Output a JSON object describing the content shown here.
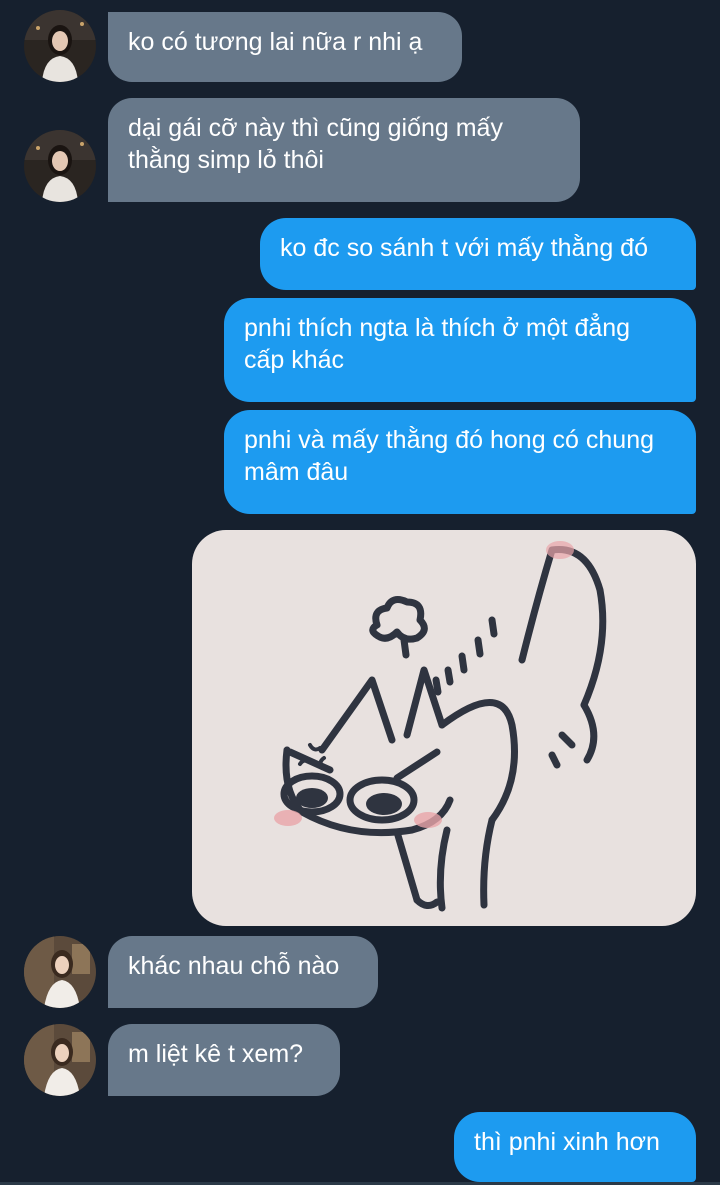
{
  "messages": [
    {
      "id": "m1",
      "side": "incoming",
      "text": "ko có tương lai nữa r nhi ạ"
    },
    {
      "id": "m2",
      "side": "incoming",
      "text": "dại gái cỡ này thì cũng giống mấy thằng simp lỏ thôi"
    },
    {
      "id": "m3",
      "side": "outgoing",
      "text": "ko đc so sánh t với mấy thằng đó"
    },
    {
      "id": "m4",
      "side": "outgoing",
      "text": "pnhi thích ngta là thích ở một đẳng cấp khác"
    },
    {
      "id": "m5",
      "side": "outgoing",
      "text": "pnhi và mấy thằng đó hong có chung mâm đâu"
    },
    {
      "id": "m6",
      "side": "outgoing",
      "type": "sticker",
      "sticker": "angry-cat-sticker"
    },
    {
      "id": "m7",
      "side": "incoming",
      "text": "khác nhau chỗ nào"
    },
    {
      "id": "m8",
      "side": "incoming",
      "text": "m liệt kê t xem?"
    },
    {
      "id": "m9",
      "side": "outgoing",
      "text": "thì pnhi xinh hơn"
    }
  ],
  "colors": {
    "background": "#16202e",
    "incoming_bubble": "#67788a",
    "outgoing_bubble": "#1d9bf0",
    "text": "#ffffff"
  }
}
